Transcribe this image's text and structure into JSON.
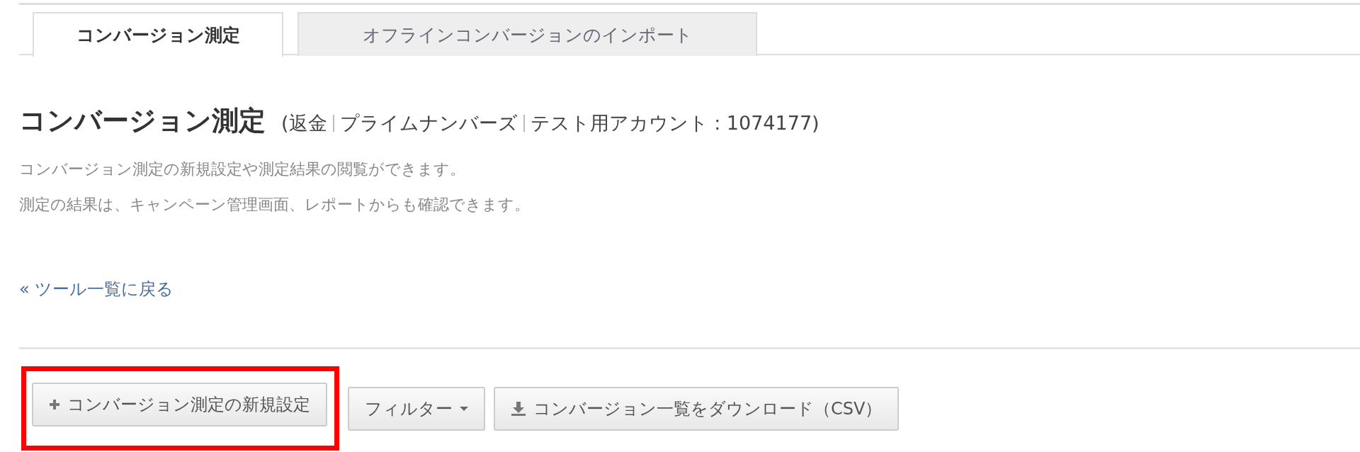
{
  "tabs": [
    {
      "label": "コンバージョン測定",
      "selected": true
    },
    {
      "label": "オフラインコンバージョンのインポート",
      "selected": false
    }
  ],
  "header": {
    "title": "コンバージョン測定",
    "context": [
      "(返金",
      "プライムナンバーズ",
      "テスト用アカウント : 1074177)"
    ]
  },
  "description": [
    "コンバージョン測定の新規設定や測定結果の閲覧ができます。",
    "測定の結果は、キャンペーン管理画面、レポートからも確認できます。"
  ],
  "back_link": "« ツール一覧に戻る",
  "toolbar": [
    {
      "kind": "add",
      "label": "コンバージョン測定の新規設定",
      "highlighted": true
    },
    {
      "kind": "dropdown",
      "label": "フィルター",
      "highlighted": false
    },
    {
      "kind": "download",
      "label": "コンバージョン一覧をダウンロード（CSV）",
      "highlighted": false
    }
  ]
}
